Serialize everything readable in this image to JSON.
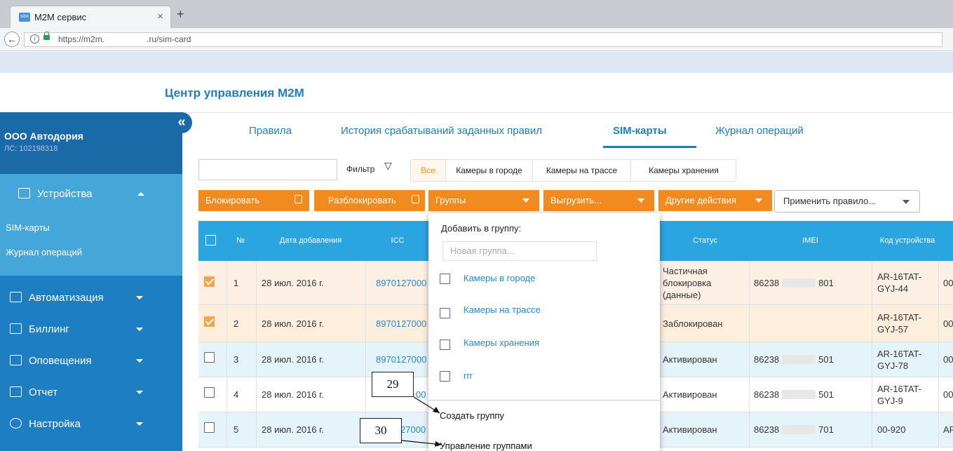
{
  "browser": {
    "tab_title": "M2M сервис",
    "tab_icon_text": "M2M",
    "url_prefix": "https://m2m.",
    "url_suffix": ".ru/sim-card"
  },
  "app": {
    "title": "Центр управления M2M"
  },
  "sidebar": {
    "company_name": "ООО Автодория",
    "account": "ЛС: 102198318",
    "collapse_glyph": "«",
    "devices": {
      "label": "Устройства",
      "items": [
        "SIM-карты",
        "Журнал операций"
      ]
    },
    "sections": [
      {
        "label": "Автоматизация",
        "icon": "automation-icon"
      },
      {
        "label": "Биллинг",
        "icon": "calculator-icon"
      },
      {
        "label": "Оповещения",
        "icon": "envelope-icon"
      },
      {
        "label": "Отчет",
        "icon": "document-icon"
      },
      {
        "label": "Настройка",
        "icon": "gear-icon"
      }
    ]
  },
  "tabs": [
    "Правила",
    "История срабатываний заданных правил",
    "SIM-карты",
    "Журнал операций"
  ],
  "active_tab": "SIM-карты",
  "filter": {
    "label": "Фильтр",
    "chips": [
      "Все",
      "Камеры в городе",
      "Камеры на трассе",
      "Камеры хранения"
    ],
    "active_chip": "Все"
  },
  "actions": {
    "block": "Блокировать",
    "unblock": "Разблокировать",
    "groups": "Группы",
    "export": "Выгрузить...",
    "other": "Другие действия",
    "rule_placeholder": "Применить правило..."
  },
  "table": {
    "headers": {
      "num": "№",
      "date": "Дата добавления",
      "iccid": "ICC",
      "status": "Статус",
      "imei": "IMEI",
      "code": "Код устройства"
    },
    "rows": [
      {
        "num": "1",
        "date": "28 июл. 2016 г.",
        "iccid": "8970127000",
        "status": "Частичная блокировка (данные)",
        "imei_start": "86238",
        "imei_end": "801",
        "code": "AR-16TAT-GYJ-44",
        "extra": "00",
        "checked": true
      },
      {
        "num": "2",
        "date": "28 июл. 2016 г.",
        "iccid": "8970127000",
        "status": "Заблокирован",
        "imei_start": "",
        "imei_end": "",
        "code": "AR-16TAT-GYJ-57",
        "extra": "00",
        "checked": true
      },
      {
        "num": "3",
        "date": "28 июл. 2016 г.",
        "iccid": "8970127000",
        "status": "Активирован",
        "imei_start": "86238",
        "imei_end": "501",
        "code": "AR-16TAT-GYJ-78",
        "extra": "00",
        "checked": false
      },
      {
        "num": "4",
        "date": "28 июл. 2016 г.",
        "iccid": "00",
        "status": "Активирован",
        "imei_start": "86238",
        "imei_end": "501",
        "code": "AR-16TAT-GYJ-9",
        "extra": "00",
        "checked": false
      },
      {
        "num": "5",
        "date": "28 июл. 2016 г.",
        "iccid": "27000",
        "status": "Активирован",
        "imei_start": "86238",
        "imei_end": "701",
        "code": "00-920",
        "extra": "AF",
        "checked": false
      }
    ]
  },
  "groups_dropdown": {
    "title": "Добавить в группу:",
    "placeholder": "Новая группа...",
    "groups": [
      "Камеры в городе",
      "Камеры на трассе",
      "Камеры хранения",
      "rrr"
    ],
    "create": "Создать группу",
    "manage": "Управление группами"
  },
  "callouts": [
    "29",
    "30"
  ]
}
